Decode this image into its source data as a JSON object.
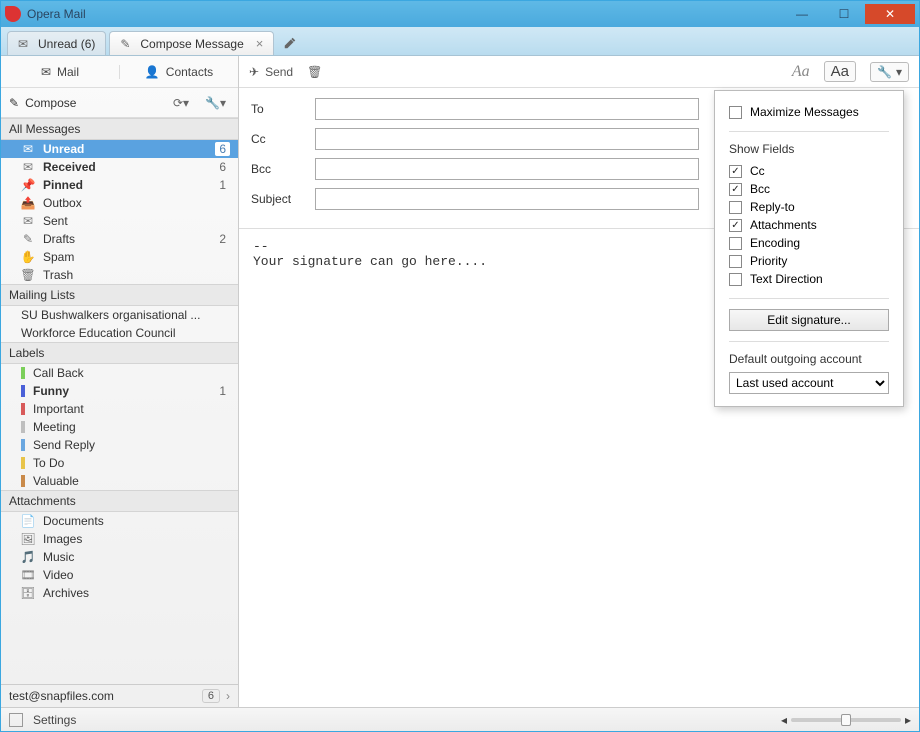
{
  "window": {
    "title": "Opera Mail"
  },
  "tabs": {
    "unread": "Unread (6)",
    "compose": "Compose Message"
  },
  "sidebar": {
    "mail": "Mail",
    "contacts": "Contacts",
    "compose": "Compose",
    "sections": {
      "all_messages": "All Messages",
      "mailing_lists": "Mailing Lists",
      "labels": "Labels",
      "attachments": "Attachments"
    },
    "folders": {
      "unread": {
        "label": "Unread",
        "count": "6"
      },
      "received": {
        "label": "Received",
        "count": "6"
      },
      "pinned": {
        "label": "Pinned",
        "count": "1"
      },
      "outbox": {
        "label": "Outbox"
      },
      "sent": {
        "label": "Sent"
      },
      "drafts": {
        "label": "Drafts",
        "count": "2"
      },
      "spam": {
        "label": "Spam"
      },
      "trash": {
        "label": "Trash"
      }
    },
    "lists": {
      "l1": "SU Bushwalkers organisational ...",
      "l2": "Workforce Education Council"
    },
    "labels": {
      "callback": {
        "label": "Call Back",
        "color": "#7bcf5a"
      },
      "funny": {
        "label": "Funny",
        "color": "#4a60d8",
        "count": "1"
      },
      "important": {
        "label": "Important",
        "color": "#d85a5a"
      },
      "meeting": {
        "label": "Meeting",
        "color": "#bfbfbf"
      },
      "sendreply": {
        "label": "Send Reply",
        "color": "#6aa7e0"
      },
      "todo": {
        "label": "To Do",
        "color": "#e8c44a"
      },
      "valuable": {
        "label": "Valuable",
        "color": "#c98a4a"
      }
    },
    "attachments": {
      "documents": "Documents",
      "images": "Images",
      "music": "Music",
      "video": "Video",
      "archives": "Archives"
    },
    "account": {
      "email": "test@snapfiles.com",
      "count": "6"
    }
  },
  "toolbar": {
    "send": "Send",
    "aa": "Aa"
  },
  "fields": {
    "to": "To",
    "cc": "Cc",
    "bcc": "Bcc",
    "subject": "Subject"
  },
  "body": "--\nYour signature can go here....",
  "dropdown": {
    "maximize": "Maximize Messages",
    "show_fields": "Show Fields",
    "cc": "Cc",
    "bcc": "Bcc",
    "replyto": "Reply-to",
    "attachments": "Attachments",
    "encoding": "Encoding",
    "priority": "Priority",
    "textdir": "Text Direction",
    "edit_sig": "Edit signature...",
    "default_acc": "Default outgoing account",
    "last_used": "Last used account"
  },
  "statusbar": {
    "settings": "Settings"
  }
}
